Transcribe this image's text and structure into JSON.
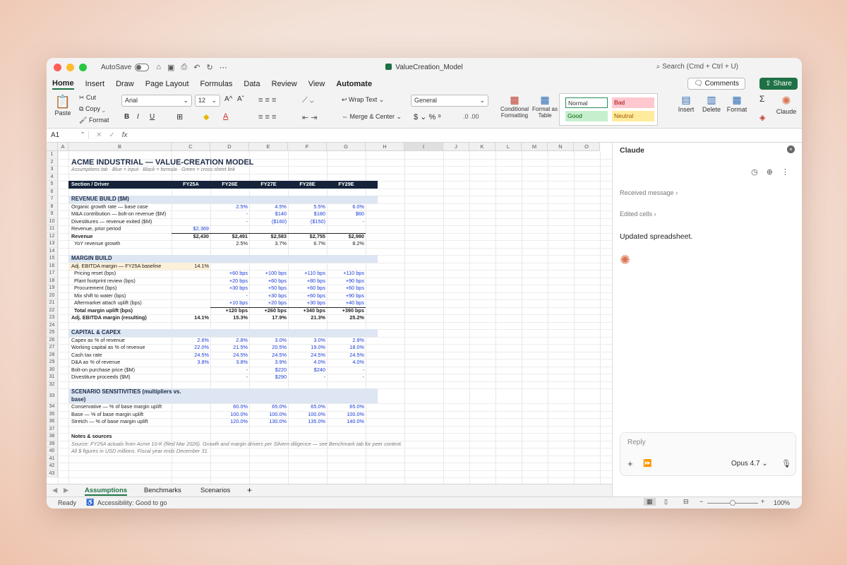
{
  "window": {
    "autosave_label": "AutoSave",
    "title": "ValueCreation_Model",
    "search_placeholder": "Search (Cmd + Ctrl + U)"
  },
  "ribbon_tabs": [
    "Home",
    "Insert",
    "Draw",
    "Page Layout",
    "Formulas",
    "Data",
    "Review",
    "View",
    "Automate"
  ],
  "ribbon": {
    "comments_label": "Comments",
    "share_label": "Share",
    "paste": "Paste",
    "cut": "Cut",
    "copy": "Copy",
    "format": "Format",
    "font_name": "Arial",
    "font_size": "12",
    "wrap_text": "Wrap Text",
    "merge_center": "Merge & Center",
    "number_format": "General",
    "conditional_formatting": "Conditional Formatting",
    "format_as_table": "Format as Table",
    "style_normal": "Normal",
    "style_bad": "Bad",
    "style_good": "Good",
    "style_neutral": "Neutral",
    "insert": "Insert",
    "delete": "Delete",
    "format_cells": "Format",
    "claude": "Claude",
    "accent_green": "#1e7145"
  },
  "formula_bar": {
    "cell_ref": "A1",
    "fx": "fx"
  },
  "columns": [
    "A",
    "B",
    "C",
    "D",
    "E",
    "F",
    "G",
    "H",
    "I",
    "J",
    "K",
    "L",
    "M",
    "N",
    "O"
  ],
  "sheet": {
    "title": "ACME INDUSTRIAL — VALUE-CREATION MODEL",
    "subtitle": "Assumptions tab  ·  Blue = input  ·  Black = formula  ·  Green = cross-sheet link",
    "header": [
      "Section / Driver",
      "FY25A",
      "FY26E",
      "FY27E",
      "FY28E",
      "FY29E"
    ],
    "rows": [
      {
        "r": 1
      },
      {
        "r": 2
      },
      {
        "r": 3
      },
      {
        "r": 4
      },
      {
        "r": 5
      },
      {
        "r": 6
      },
      {
        "r": 7,
        "label": "REVENUE BUILD ($M)",
        "section": true
      },
      {
        "r": 8,
        "label": "Organic growth rate — base case",
        "vals": [
          "",
          "2.5%",
          "4.5%",
          "5.5%",
          "6.0%"
        ],
        "blue": true
      },
      {
        "r": 9,
        "label": "M&A contribution — bolt-on revenue ($M)",
        "vals": [
          "",
          "-",
          "$140",
          "$180",
          "$60"
        ],
        "blue": true
      },
      {
        "r": 10,
        "label": "Divestitures — revenue exited ($M)",
        "vals": [
          "",
          "-",
          "($160)",
          "($150)",
          "-"
        ],
        "blue": true
      },
      {
        "r": 11,
        "label": "Revenue, prior period",
        "vals": [
          "$2,369",
          "",
          "",
          "",
          ""
        ],
        "blue": true
      },
      {
        "r": 12,
        "label": "Revenue",
        "vals": [
          "$2,430",
          "$2,491",
          "$2,583",
          "$2,755",
          "$2,980"
        ],
        "bold": true
      },
      {
        "r": 13,
        "label": "YoY revenue growth",
        "vals": [
          "",
          "2.5%",
          "3.7%",
          "6.7%",
          "8.2%"
        ],
        "indent": true
      },
      {
        "r": 14
      },
      {
        "r": 15,
        "label": "MARGIN BUILD",
        "section": true
      },
      {
        "r": 16,
        "label": "Adj. EBITDA margin — FY25A baseline",
        "vals": [
          "14.1%",
          "",
          "",
          "",
          ""
        ],
        "hilite": true
      },
      {
        "r": 17,
        "label": "Pricing reset (bps)",
        "vals": [
          "",
          "+60 bps",
          "+100 bps",
          "+110 bps",
          "+110 bps"
        ],
        "blue": true,
        "indent": true
      },
      {
        "r": 18,
        "label": "Plant footprint review (bps)",
        "vals": [
          "",
          "+20 bps",
          "+60 bps",
          "+80 bps",
          "+90 bps"
        ],
        "blue": true,
        "indent": true
      },
      {
        "r": 19,
        "label": "Procurement (bps)",
        "vals": [
          "",
          "+30 bps",
          "+50 bps",
          "+60 bps",
          "+60 bps"
        ],
        "blue": true,
        "indent": true
      },
      {
        "r": 20,
        "label": "Mix shift to water (bps)",
        "vals": [
          "",
          "-",
          "+30 bps",
          "+60 bps",
          "+90 bps"
        ],
        "blue": true,
        "indent": true
      },
      {
        "r": 21,
        "label": "Aftermarket attach uplift (bps)",
        "vals": [
          "",
          "+10 bps",
          "+20 bps",
          "+30 bps",
          "+40 bps"
        ],
        "blue": true,
        "indent": true
      },
      {
        "r": 22,
        "label": "Total margin uplift (bps)",
        "vals": [
          "",
          "+120 bps",
          "+260 bps",
          "+340 bps",
          "+390 bps"
        ],
        "bold": true,
        "indent": true
      },
      {
        "r": 23,
        "label": "Adj. EBITDA margin (resulting)",
        "vals": [
          "14.1%",
          "15.3%",
          "17.9%",
          "21.3%",
          "25.2%"
        ],
        "bold": true
      },
      {
        "r": 24
      },
      {
        "r": 25,
        "label": "CAPITAL & CAPEX",
        "section": true
      },
      {
        "r": 26,
        "label": "Capex as % of revenue",
        "vals": [
          "2.6%",
          "2.8%",
          "3.0%",
          "3.0%",
          "2.8%"
        ],
        "blue": true
      },
      {
        "r": 27,
        "label": "Working capital as % of revenue",
        "vals": [
          "22.0%",
          "21.5%",
          "20.5%",
          "19.0%",
          "18.0%"
        ],
        "blue": true
      },
      {
        "r": 28,
        "label": "Cash tax rate",
        "vals": [
          "24.5%",
          "24.5%",
          "24.5%",
          "24.5%",
          "24.5%"
        ],
        "blue": true
      },
      {
        "r": 29,
        "label": "D&A as % of revenue",
        "vals": [
          "3.8%",
          "3.8%",
          "3.9%",
          "4.0%",
          "4.0%"
        ],
        "blue": true
      },
      {
        "r": 30,
        "label": "Bolt-on purchase price ($M)",
        "vals": [
          "",
          "-",
          "$220",
          "$240",
          "-"
        ],
        "blue": true
      },
      {
        "r": 31,
        "label": "Divestiture proceeds ($M)",
        "vals": [
          "",
          "-",
          "$290",
          "-",
          "-"
        ],
        "blue": true
      },
      {
        "r": 32
      },
      {
        "r": 33,
        "label": "SCENARIO SENSITIVITIES (multipliers vs. base)",
        "section": true,
        "tall": true
      },
      {
        "r": 34,
        "label": "Conservative — % of base margin uplift",
        "vals": [
          "",
          "60.0%",
          "65.0%",
          "65.0%",
          "65.0%"
        ],
        "blue": true
      },
      {
        "r": 35,
        "label": "Base — % of base margin uplift",
        "vals": [
          "",
          "100.0%",
          "100.0%",
          "100.0%",
          "100.0%"
        ],
        "blue": true
      },
      {
        "r": 36,
        "label": "Stretch — % of base margin uplift",
        "vals": [
          "",
          "120.0%",
          "130.0%",
          "135.0%",
          "140.0%"
        ],
        "blue": true
      },
      {
        "r": 37
      },
      {
        "r": 38,
        "label": "Notes & sources",
        "bold": true
      },
      {
        "r": 39,
        "label": "Source: FY25A actuals from Acme 10-K (filed Mar 2026). Growth and margin drivers per Silvern diligence — see Benchmark tab for peer context.",
        "note": true
      },
      {
        "r": 40,
        "label": "All $ figures in USD millions. Fiscal year ends December 31.",
        "note": true
      },
      {
        "r": 41
      },
      {
        "r": 42
      },
      {
        "r": 43
      }
    ]
  },
  "sheet_tabs": [
    "Assumptions",
    "Benchmarks",
    "Scenarios"
  ],
  "status": {
    "ready": "Ready",
    "accessibility": "Accessibility: Good to go",
    "zoom": "100%"
  },
  "claude_panel": {
    "title": "Claude",
    "received": "Received message",
    "edited": "Edited cells",
    "message": "Updated spreadsheet.",
    "reply_placeholder": "Reply",
    "model": "Opus 4.7",
    "accent": "#d9734f"
  }
}
